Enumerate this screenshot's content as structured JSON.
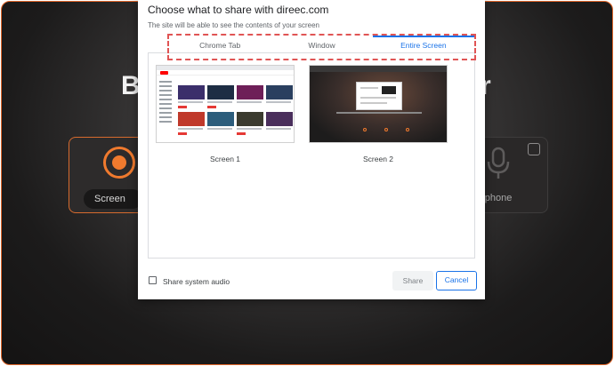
{
  "background": {
    "title_left": "B",
    "title_right": "r",
    "screen_mode_label": "Screen",
    "microphone_label": "rophone"
  },
  "dialog": {
    "title": "Choose what to share with direec.com",
    "subtitle": "The site will be able to see the contents of your screen",
    "tabs": [
      {
        "label": "Chrome Tab",
        "active": false
      },
      {
        "label": "Window",
        "active": false
      },
      {
        "label": "Entire Screen",
        "active": true
      }
    ],
    "screens": [
      {
        "label": "Screen 1"
      },
      {
        "label": "Screen 2"
      }
    ],
    "share_audio_label": "Share system audio",
    "share_audio_checked": false,
    "share_button": "Share",
    "cancel_button": "Cancel"
  },
  "colors": {
    "accent": "#1a73e8",
    "app_accent": "#f07a2e",
    "highlight_dashed": "#e05454"
  },
  "icons": {
    "record": "record-icon",
    "microphone": "microphone-icon"
  }
}
